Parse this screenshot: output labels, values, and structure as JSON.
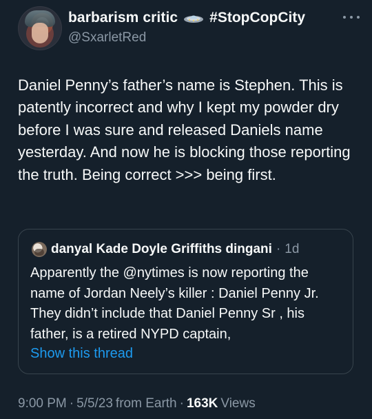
{
  "tweet": {
    "author": {
      "display_name": "barbarism critic",
      "emoji_icon": "flying-saucer-icon",
      "hashtag": "#StopCopCity",
      "handle": "@SxarletRed"
    },
    "text": "Daniel Penny’s father’s name is Stephen. This is patently incorrect and why I kept my powder dry before I was sure and released Daniels name yesterday. And now he is blocking those reporting the truth. Being correct >>> being first.",
    "quote": {
      "author_name": "danyal Kade Doyle Griffiths dingani",
      "dot": "·",
      "time": "1d",
      "text": "Apparently the @nytimes is now reporting the name of Jordan Neely’s killer : Daniel Penny Jr. They didn’t include that Daniel Penny Sr , his father, is a retired NYPD captain,",
      "show_thread": "Show this thread"
    },
    "meta": {
      "time": "9:00 PM",
      "dot1": "·",
      "date": "5/5/23",
      "source": "from Earth",
      "dot2": "·",
      "views_count": "163K",
      "views_label": "Views"
    }
  },
  "colors": {
    "background": "#15202b",
    "primary_text": "#f7f9f9",
    "secondary_text": "#8b98a5",
    "link": "#1d9bf0",
    "border": "#38444d"
  }
}
